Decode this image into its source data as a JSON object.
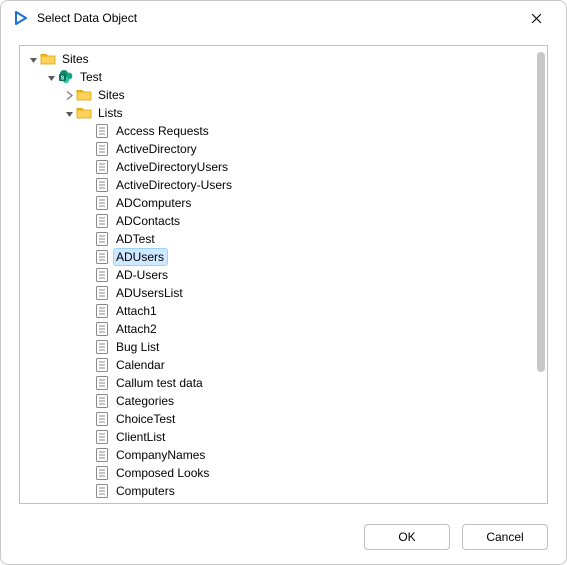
{
  "window": {
    "title": "Select Data Object"
  },
  "buttons": {
    "ok": "OK",
    "cancel": "Cancel"
  },
  "selected_path": "Sites/Test/Lists/ADUsers",
  "tree": {
    "root": {
      "label": "Sites",
      "icon": "folder",
      "expanded": true,
      "children": [
        {
          "label": "Test",
          "icon": "sharepoint",
          "expanded": true,
          "children": [
            {
              "label": "Sites",
              "icon": "folder",
              "expanded": false,
              "children": []
            },
            {
              "label": "Lists",
              "icon": "folder",
              "expanded": true,
              "children": [
                {
                  "label": "Access Requests",
                  "icon": "list"
                },
                {
                  "label": "ActiveDirectory",
                  "icon": "list"
                },
                {
                  "label": "ActiveDirectoryUsers",
                  "icon": "list"
                },
                {
                  "label": "ActiveDirectory-Users",
                  "icon": "list"
                },
                {
                  "label": "ADComputers",
                  "icon": "list"
                },
                {
                  "label": "ADContacts",
                  "icon": "list"
                },
                {
                  "label": "ADTest",
                  "icon": "list"
                },
                {
                  "label": "ADUsers",
                  "icon": "list",
                  "selected": true
                },
                {
                  "label": "AD-Users",
                  "icon": "list"
                },
                {
                  "label": "ADUsersList",
                  "icon": "list"
                },
                {
                  "label": "Attach1",
                  "icon": "list"
                },
                {
                  "label": "Attach2",
                  "icon": "list"
                },
                {
                  "label": "Bug List",
                  "icon": "list"
                },
                {
                  "label": "Calendar",
                  "icon": "list"
                },
                {
                  "label": "Callum test data",
                  "icon": "list"
                },
                {
                  "label": "Categories",
                  "icon": "list"
                },
                {
                  "label": "ChoiceTest",
                  "icon": "list"
                },
                {
                  "label": "ClientList",
                  "icon": "list"
                },
                {
                  "label": "CompanyNames",
                  "icon": "list"
                },
                {
                  "label": "Composed Looks",
                  "icon": "list"
                },
                {
                  "label": "Computers",
                  "icon": "list"
                }
              ]
            }
          ]
        }
      ]
    }
  }
}
